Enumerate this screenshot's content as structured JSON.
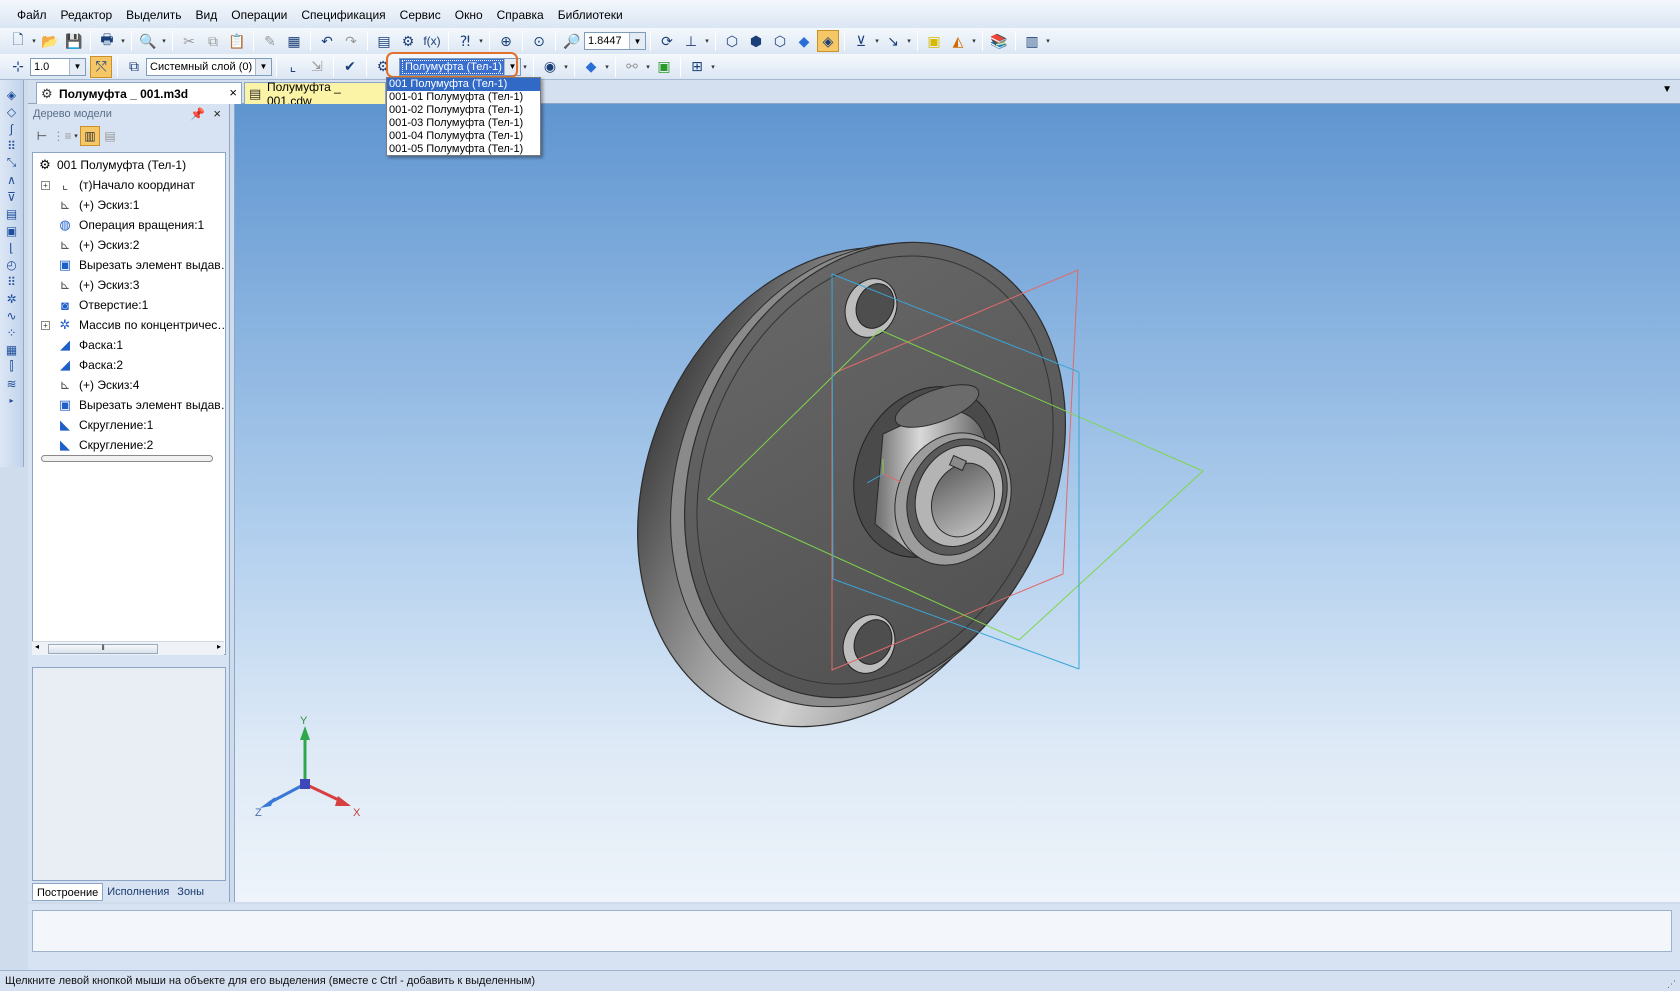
{
  "menu": [
    "Файл",
    "Редактор",
    "Выделить",
    "Вид",
    "Операции",
    "Спецификация",
    "Сервис",
    "Окно",
    "Справка",
    "Библиотеки"
  ],
  "toolbar1": {
    "zoom_value": "1.8447",
    "icons": [
      "new-icon",
      "open-icon",
      "save-icon",
      "print-icon",
      "preview-icon",
      "cut-icon",
      "copy-icon",
      "paste-icon",
      "brush-icon",
      "table-icon",
      "undo-icon",
      "redo-icon",
      "tree-icon",
      "manager-icon",
      "fx-icon",
      "help-icon",
      "zoom-window-icon",
      "zoom-all-icon",
      "zoom-in-icon",
      "rotate-icon",
      "orientation-icon",
      "wireframe-icon",
      "hidden-lines-icon",
      "shaded-icon",
      "shaded-edges-icon",
      "perspective-icon",
      "filter-icon",
      "sketch-icon",
      "cube-icon",
      "color-icon",
      "library-icon",
      "calc-icon"
    ]
  },
  "toolbar2": {
    "step_value": "1.0",
    "layer_value": "Системный слой (0)",
    "configuration_value": "Полумуфта (Тел-1)",
    "configuration_options": [
      "001 Полумуфта (Тел-1)",
      "001-01 Полумуфта (Тел-1)",
      "001-02 Полумуфта (Тел-1)",
      "001-03 Полумуфта (Тел-1)",
      "001-04 Полумуфта (Тел-1)",
      "001-05 Полумуфта (Тел-1)"
    ]
  },
  "tabs": [
    {
      "label": "Полумуфта _ 001.m3d",
      "active": true
    },
    {
      "label": "Полумуфта _ 001.cdw",
      "active": false
    }
  ],
  "tree_panel": {
    "title": "Дерево модели",
    "items": [
      {
        "label": "001 Полумуфта (Тел-1)",
        "icon": "part-icon",
        "level": 0
      },
      {
        "label": "(т)Начало координат",
        "icon": "origin-icon",
        "level": 1,
        "expandable": true
      },
      {
        "label": "(+) Эскиз:1",
        "icon": "sketch-icon",
        "level": 1
      },
      {
        "label": "Операция вращения:1",
        "icon": "revolve-icon",
        "level": 1
      },
      {
        "label": "(+) Эскиз:2",
        "icon": "sketch-icon",
        "level": 1
      },
      {
        "label": "Вырезать элемент выдав…",
        "icon": "cut-extrude-icon",
        "level": 1
      },
      {
        "label": "(+) Эскиз:3",
        "icon": "sketch-icon",
        "level": 1
      },
      {
        "label": "Отверстие:1",
        "icon": "hole-icon",
        "level": 1
      },
      {
        "label": "Массив по концентричес…",
        "icon": "circular-pattern-icon",
        "level": 1,
        "expandable": true
      },
      {
        "label": "Фаска:1",
        "icon": "chamfer-icon",
        "level": 1
      },
      {
        "label": "Фаска:2",
        "icon": "chamfer-icon",
        "level": 1
      },
      {
        "label": "(+) Эскиз:4",
        "icon": "sketch-icon",
        "level": 1
      },
      {
        "label": "Вырезать элемент выдав…",
        "icon": "cut-extrude-icon",
        "level": 1
      },
      {
        "label": "Скругление:1",
        "icon": "fillet-icon",
        "level": 1
      },
      {
        "label": "Скругление:2",
        "icon": "fillet-icon",
        "level": 1
      }
    ],
    "bottom_tabs": [
      "Построение",
      "Исполнения",
      "Зоны"
    ]
  },
  "viewport": {
    "axes": {
      "x": "X",
      "y": "Y",
      "z": "Z"
    },
    "colors": {
      "plane_red": "#e06a6a",
      "plane_green": "#7ed64a",
      "plane_blue": "#3aa6d8",
      "part": "#5e5e5e"
    }
  },
  "status": "Щелкните левой кнопкой мыши на объекте для его выделения (вместе с Ctrl - добавить к выделенным)"
}
